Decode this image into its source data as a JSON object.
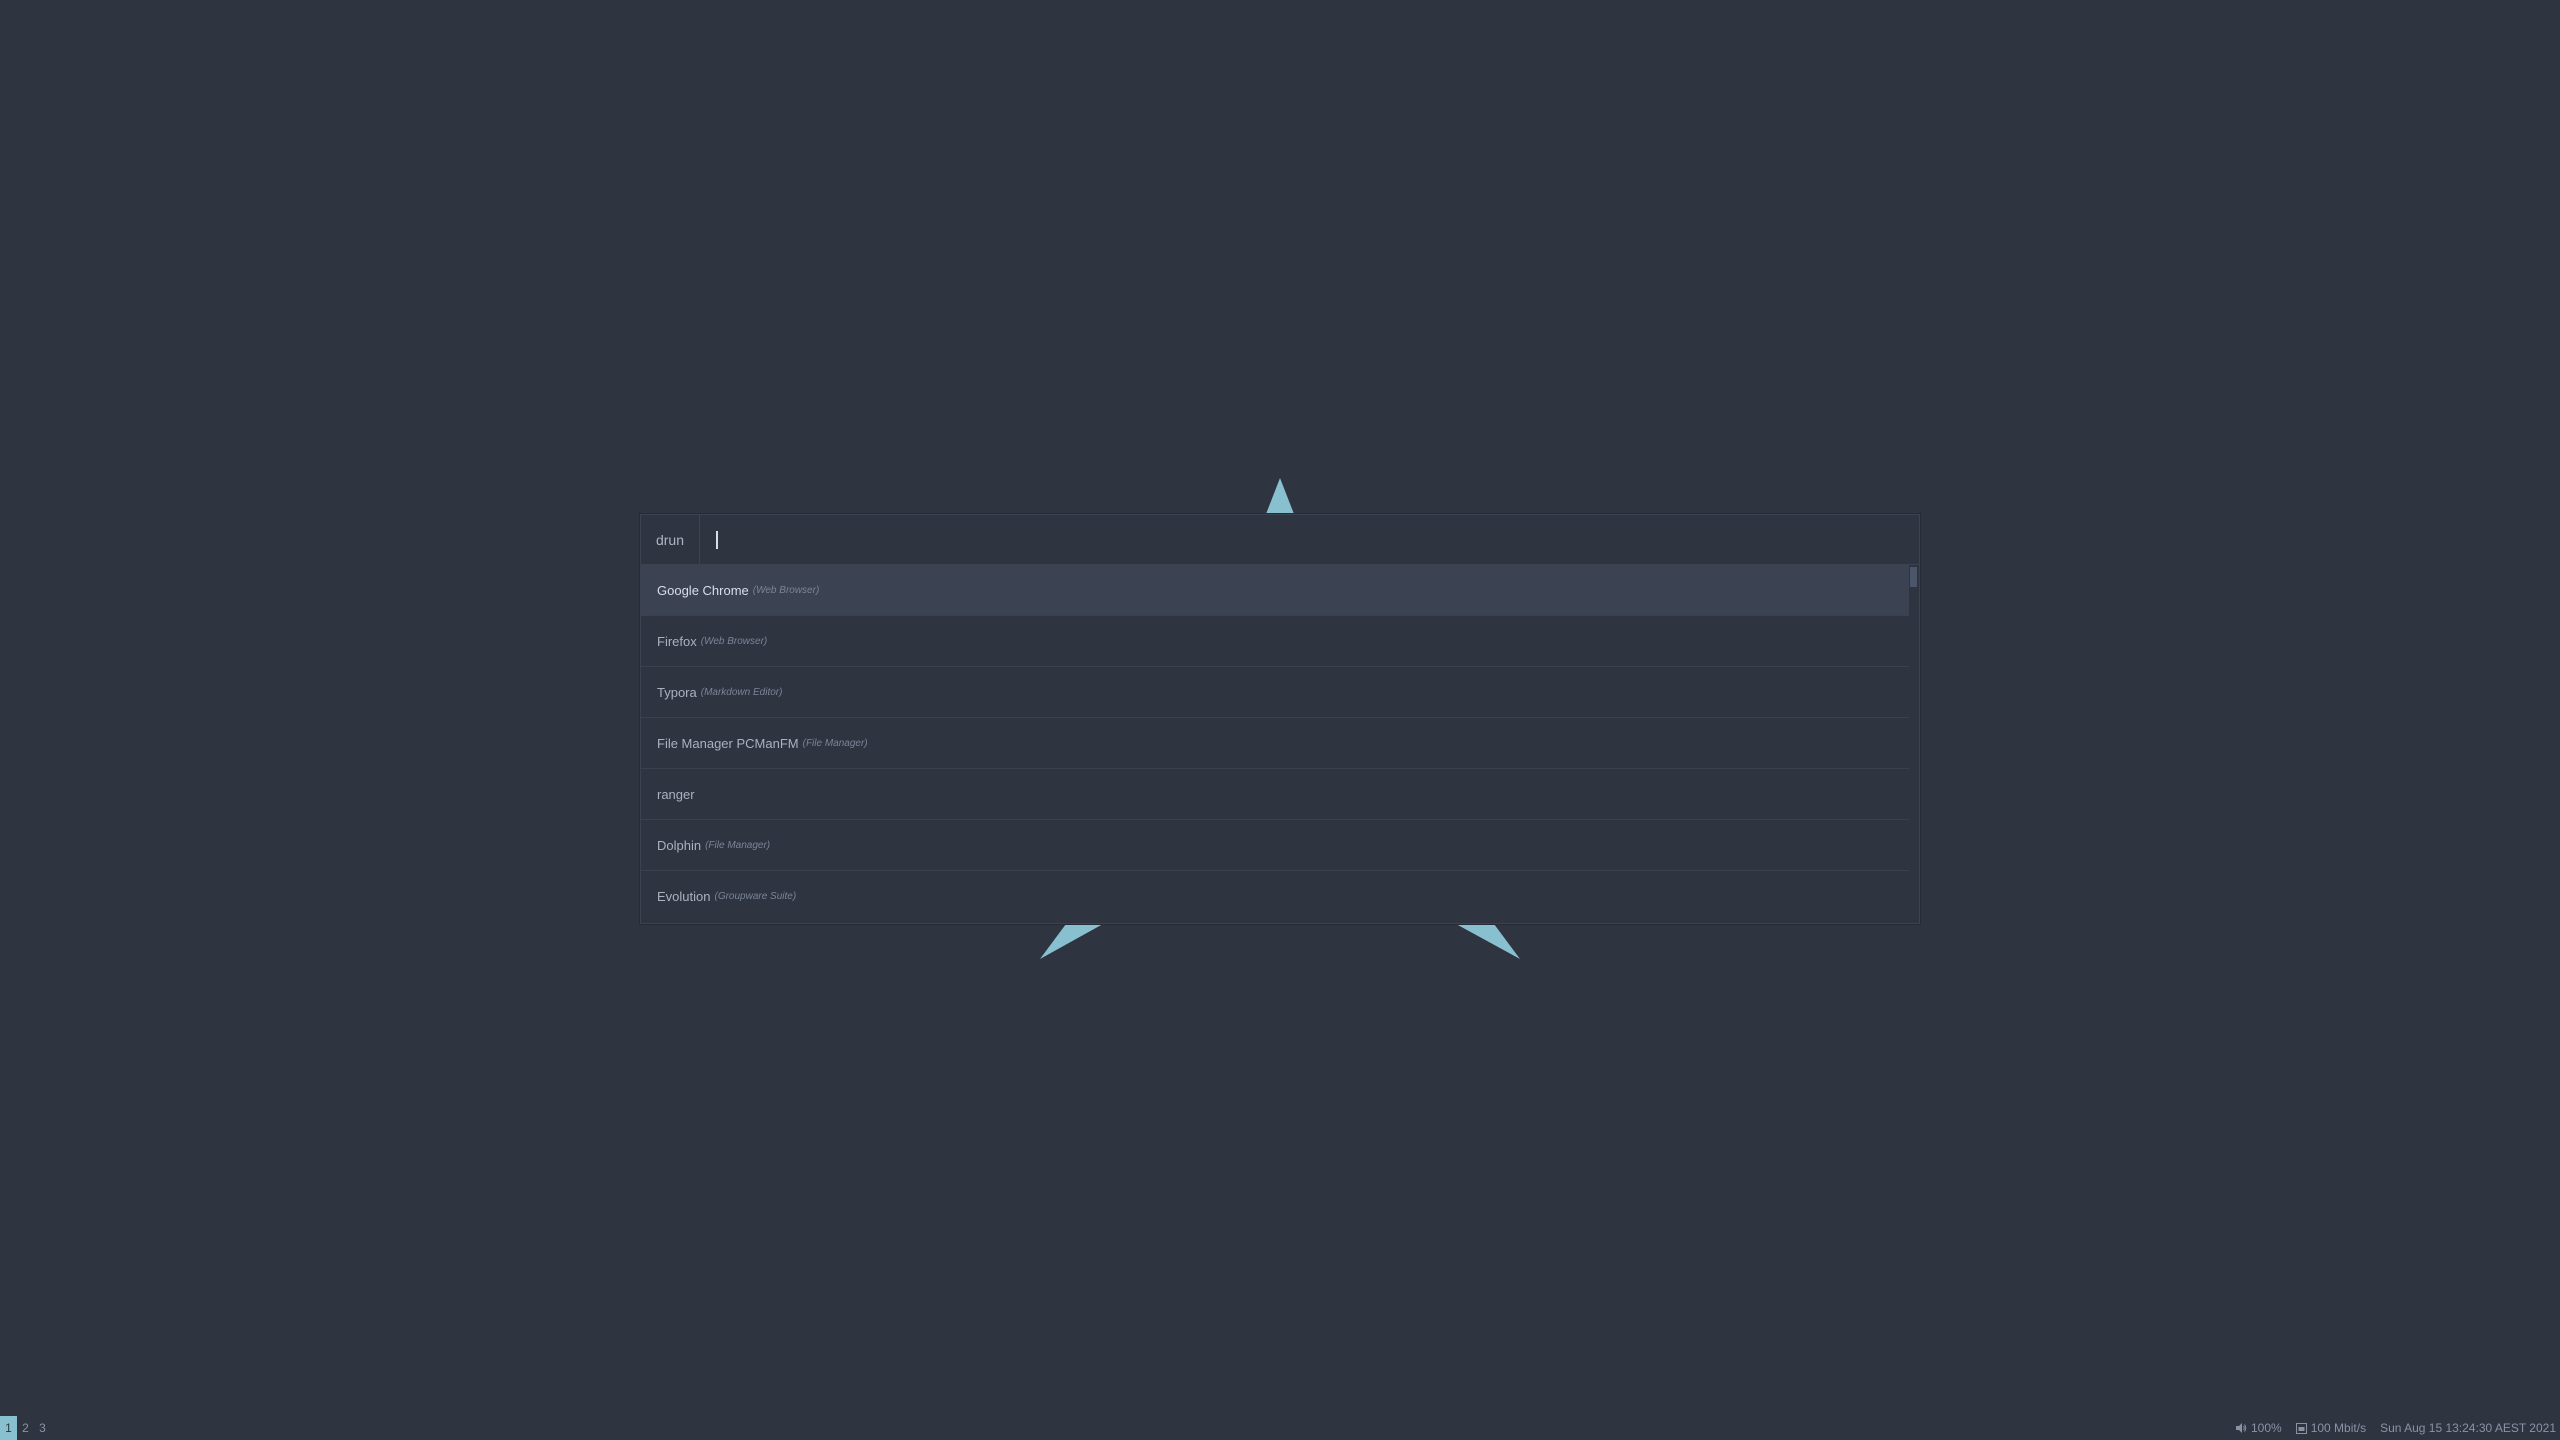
{
  "wallpaper": {
    "accent_color": "#88c0d0",
    "background_color": "#2e3440"
  },
  "launcher": {
    "mode_prompt": "drun",
    "entry_value": "",
    "items": [
      {
        "name": "Google Chrome",
        "generic": "(Web Browser)",
        "selected": true
      },
      {
        "name": "Firefox",
        "generic": "(Web Browser)",
        "selected": false
      },
      {
        "name": "Typora",
        "generic": "(Markdown Editor)",
        "selected": false
      },
      {
        "name": "File Manager PCManFM",
        "generic": "(File Manager)",
        "selected": false
      },
      {
        "name": "ranger",
        "generic": "",
        "selected": false
      },
      {
        "name": "Dolphin",
        "generic": "(File Manager)",
        "selected": false
      },
      {
        "name": "Evolution",
        "generic": "(Groupware Suite)",
        "selected": false
      }
    ]
  },
  "statusbar": {
    "workspaces": [
      {
        "label": "1",
        "active": true
      },
      {
        "label": "2",
        "active": false
      },
      {
        "label": "3",
        "active": false
      }
    ],
    "volume": {
      "icon": "speaker-icon",
      "text": "100%"
    },
    "network": {
      "icon": "ethernet-icon",
      "text": "100 Mbit/s"
    },
    "clock": "Sun Aug 15 13:24:30 AEST 2021"
  }
}
